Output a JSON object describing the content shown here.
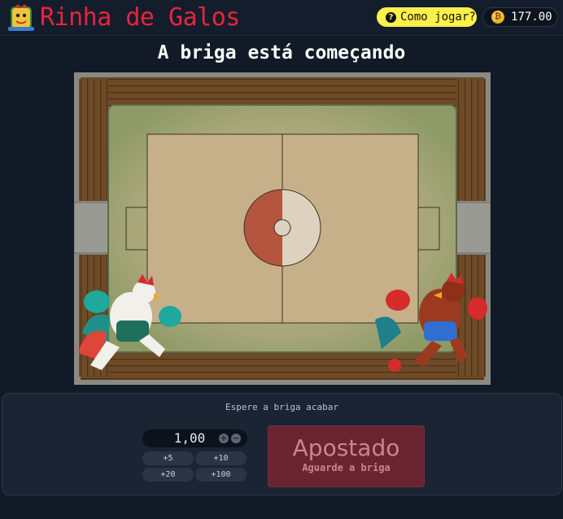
{
  "app": {
    "title": "Rinha de Galos",
    "help_label": "Como jogar?",
    "balance": "177.00"
  },
  "game": {
    "headline": "A briga está começando"
  },
  "bet_panel": {
    "status_message": "Espere a briga acabar",
    "amount": "1,00",
    "quick_amounts": [
      "+5",
      "+10",
      "+20",
      "+100"
    ],
    "bet_title": "Apostado",
    "bet_subtitle": "Aguarde a briga"
  },
  "colors": {
    "brand": "#e8243c",
    "help_button": "#fff04a",
    "background": "#111a26",
    "panel": "#1b2433",
    "bet_button": "#6a2330"
  },
  "icons": {
    "logo": "rooster-logo-icon",
    "help": "question-circle-icon",
    "coin": "coin-icon",
    "increment": "plus-circle-icon",
    "decrement": "minus-circle-icon"
  }
}
